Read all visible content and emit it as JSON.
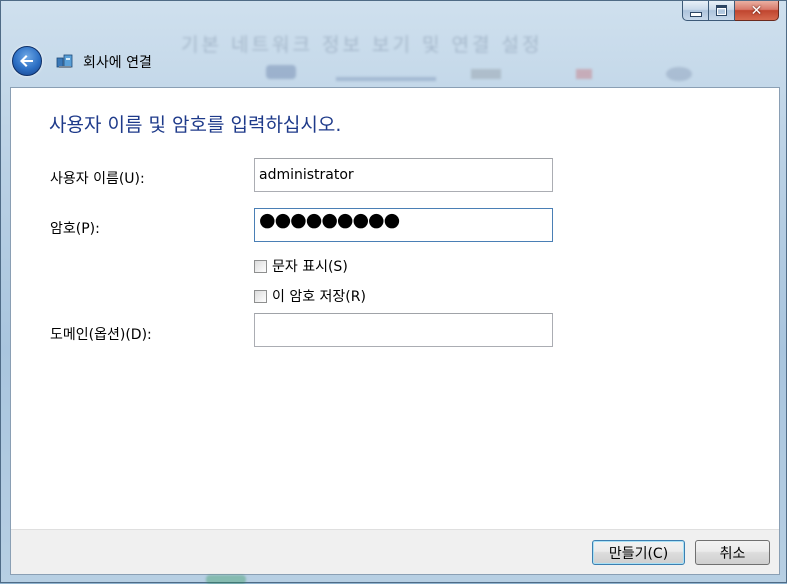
{
  "window": {
    "title": "회사에 연결",
    "background_text": "기본 네트워크 정보 보기 및 연결 설정"
  },
  "content": {
    "heading": "사용자 이름 및 암호를 입력하십시오.",
    "username": {
      "label": "사용자 이름(U):",
      "value": "administrator"
    },
    "password": {
      "label": "암호(P):",
      "masked_value": "●●●●●●●●●"
    },
    "show_chars": {
      "label": "문자 표시(S)",
      "checked": false
    },
    "save_password": {
      "label": "이 암호 저장(R)",
      "checked": false
    },
    "domain": {
      "label": "도메인(옵션)(D):",
      "value": ""
    }
  },
  "footer": {
    "create_label": "만들기(C)",
    "cancel_label": "취소"
  },
  "colors": {
    "heading": "#1e3a8a",
    "close_button": "#c0452f",
    "default_button_border": "#3c7fb1"
  }
}
